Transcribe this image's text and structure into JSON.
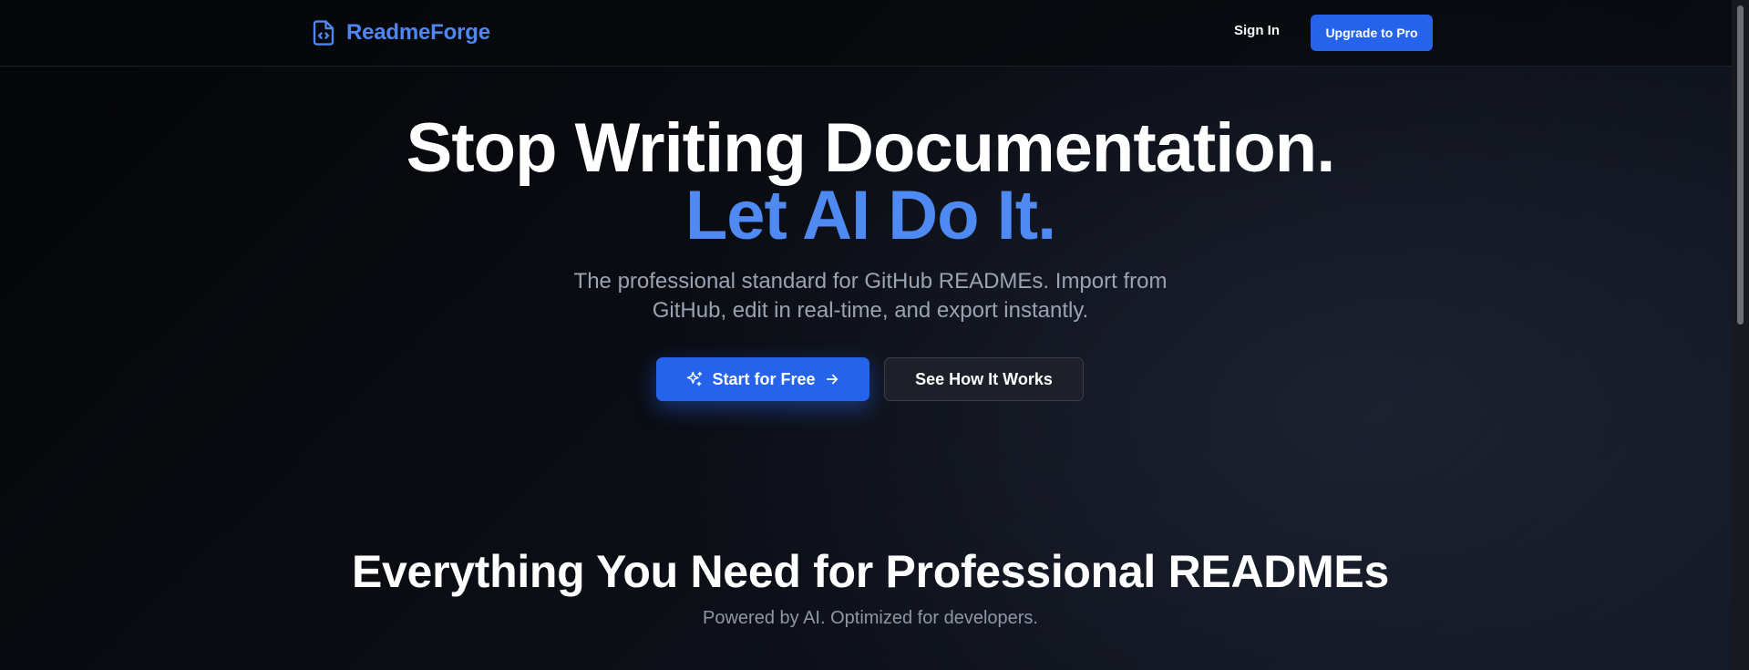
{
  "header": {
    "brand": "ReadmeForge",
    "brand_icon": "file-code-icon",
    "sign_in": "Sign In",
    "upgrade": "Upgrade to Pro"
  },
  "hero": {
    "headline_line1": "Stop Writing Documentation.",
    "headline_line2": "Let AI Do It.",
    "subtitle": "The professional standard for GitHub READMEs. Import from GitHub, edit in real-time, and export instantly.",
    "primary_cta": "Start for Free",
    "primary_cta_icons": [
      "sparkles-icon",
      "arrow-right-icon"
    ],
    "secondary_cta": "See How It Works"
  },
  "features": {
    "title": "Everything You Need for Professional READMEs",
    "subtitle": "Powered by AI. Optimized for developers."
  },
  "colors": {
    "accent": "#2563eb",
    "brand_text": "#4f86f0",
    "headline_accent": "#4f8af2",
    "background": "#07080c"
  }
}
